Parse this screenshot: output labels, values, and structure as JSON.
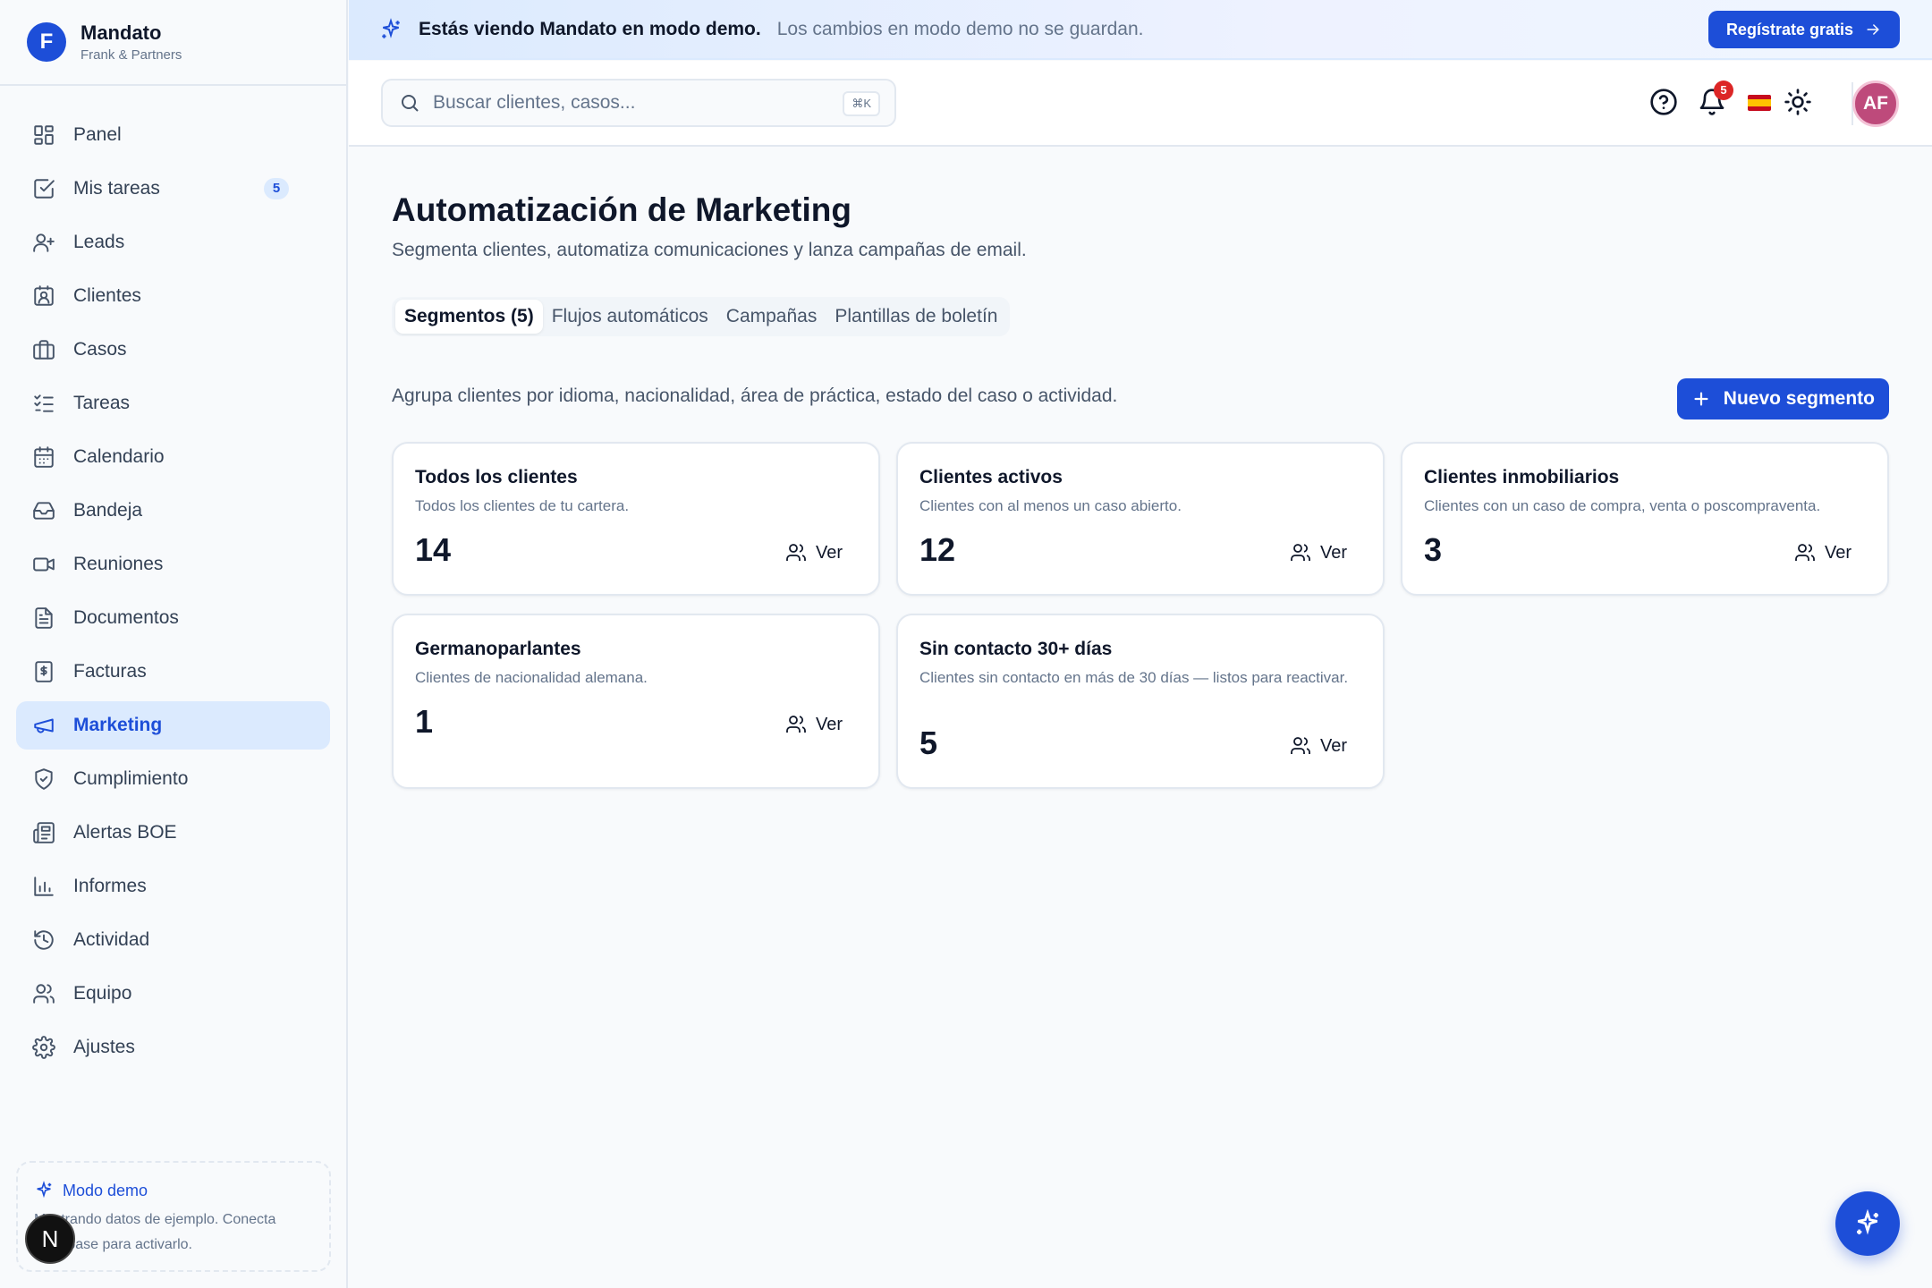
{
  "brand": {
    "logo_letter": "F",
    "name": "Mandato",
    "sub": "Frank & Partners"
  },
  "banner": {
    "strong": "Estás viendo Mandato en modo demo.",
    "text": "Los cambios en modo demo no se guardan.",
    "cta": "Regístrate gratis"
  },
  "sidebar": {
    "items": [
      {
        "label": "Panel",
        "icon": "grid-icon"
      },
      {
        "label": "Mis tareas",
        "icon": "checkbox-icon",
        "badge": "5"
      },
      {
        "label": "Leads",
        "icon": "user-plus-icon"
      },
      {
        "label": "Clientes",
        "icon": "contact-card-icon"
      },
      {
        "label": "Casos",
        "icon": "briefcase-icon"
      },
      {
        "label": "Tareas",
        "icon": "list-check-icon"
      },
      {
        "label": "Calendario",
        "icon": "calendar-icon"
      },
      {
        "label": "Bandeja",
        "icon": "inbox-icon"
      },
      {
        "label": "Reuniones",
        "icon": "video-icon"
      },
      {
        "label": "Documentos",
        "icon": "document-icon"
      },
      {
        "label": "Facturas",
        "icon": "invoice-icon"
      },
      {
        "label": "Marketing",
        "icon": "megaphone-icon",
        "active": true
      },
      {
        "label": "Cumplimiento",
        "icon": "shield-icon"
      },
      {
        "label": "Alertas BOE",
        "icon": "newspaper-icon"
      },
      {
        "label": "Informes",
        "icon": "bar-chart-icon"
      },
      {
        "label": "Actividad",
        "icon": "history-icon"
      },
      {
        "label": "Equipo",
        "icon": "users-icon"
      },
      {
        "label": "Ajustes",
        "icon": "gear-icon"
      }
    ],
    "demo": {
      "title": "Modo demo",
      "text": "Mostrando datos de ejemplo. Conecta Supabase para activarlo."
    },
    "n_badge": "N"
  },
  "topbar": {
    "search_placeholder": "Buscar clientes, casos...",
    "shortcut": "⌘K",
    "notifications": "5",
    "avatar": "AF"
  },
  "page": {
    "title": "Automatización de Marketing",
    "subtitle": "Segmenta clientes, automatiza comunicaciones y lanza campañas de email.",
    "tabs": [
      "Segmentos (5)",
      "Flujos automáticos",
      "Campañas",
      "Plantillas de boletín"
    ],
    "segments_description": "Agrupa clientes por idioma, nacionalidad, área de práctica, estado del caso o actividad.",
    "new_segment": "Nuevo segmento",
    "view_label": "Ver",
    "segments": [
      {
        "title": "Todos los clientes",
        "desc": "Todos los clientes de tu cartera.",
        "count": "14"
      },
      {
        "title": "Clientes activos",
        "desc": "Clientes con al menos un caso abierto.",
        "count": "12"
      },
      {
        "title": "Clientes inmobiliarios",
        "desc": "Clientes con un caso de compra, venta o poscompraventa.",
        "count": "3"
      },
      {
        "title": "Germanoparlantes",
        "desc": "Clientes de nacionalidad alemana.",
        "count": "1"
      },
      {
        "title": "Sin contacto 30+ días",
        "desc": "Clientes sin contacto en más de 30 días — listos para reactivar.",
        "count": "5"
      }
    ]
  },
  "colors": {
    "accent": "#1d4ed8",
    "active_bg": "#dbeafe",
    "avatar": "#be4a7b",
    "badge_red": "#dc2626"
  }
}
